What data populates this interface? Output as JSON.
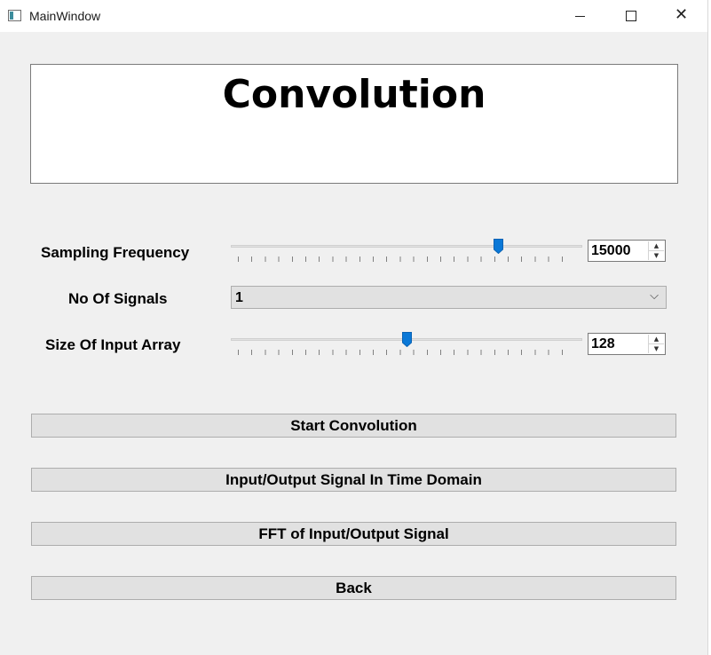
{
  "window": {
    "title": "MainWindow"
  },
  "heading": "Convolution",
  "controls": {
    "sampling_frequency": {
      "label": "Sampling Frequency",
      "value": "15000",
      "slider_fraction": 0.77
    },
    "no_of_signals": {
      "label": "No Of Signals",
      "selected": "1"
    },
    "input_array_size": {
      "label": "Size Of Input Array",
      "value": "128",
      "slider_fraction": 0.5
    }
  },
  "buttons": {
    "start": "Start Convolution",
    "time_domain": "Input/Output Signal In Time Domain",
    "fft": "FFT of Input/Output Signal",
    "back": "Back"
  },
  "icons": {
    "app": "app-window-icon",
    "minimize": "minimize-icon",
    "maximize": "maximize-icon",
    "close": "close-icon",
    "spin_up": "arrow-up-icon",
    "spin_down": "arrow-down-icon",
    "dropdown": "chevron-down-icon"
  },
  "colors": {
    "slider_handle": "#0a78d7",
    "window_bg": "#f0f0f0",
    "button_bg": "#e1e1e1"
  }
}
